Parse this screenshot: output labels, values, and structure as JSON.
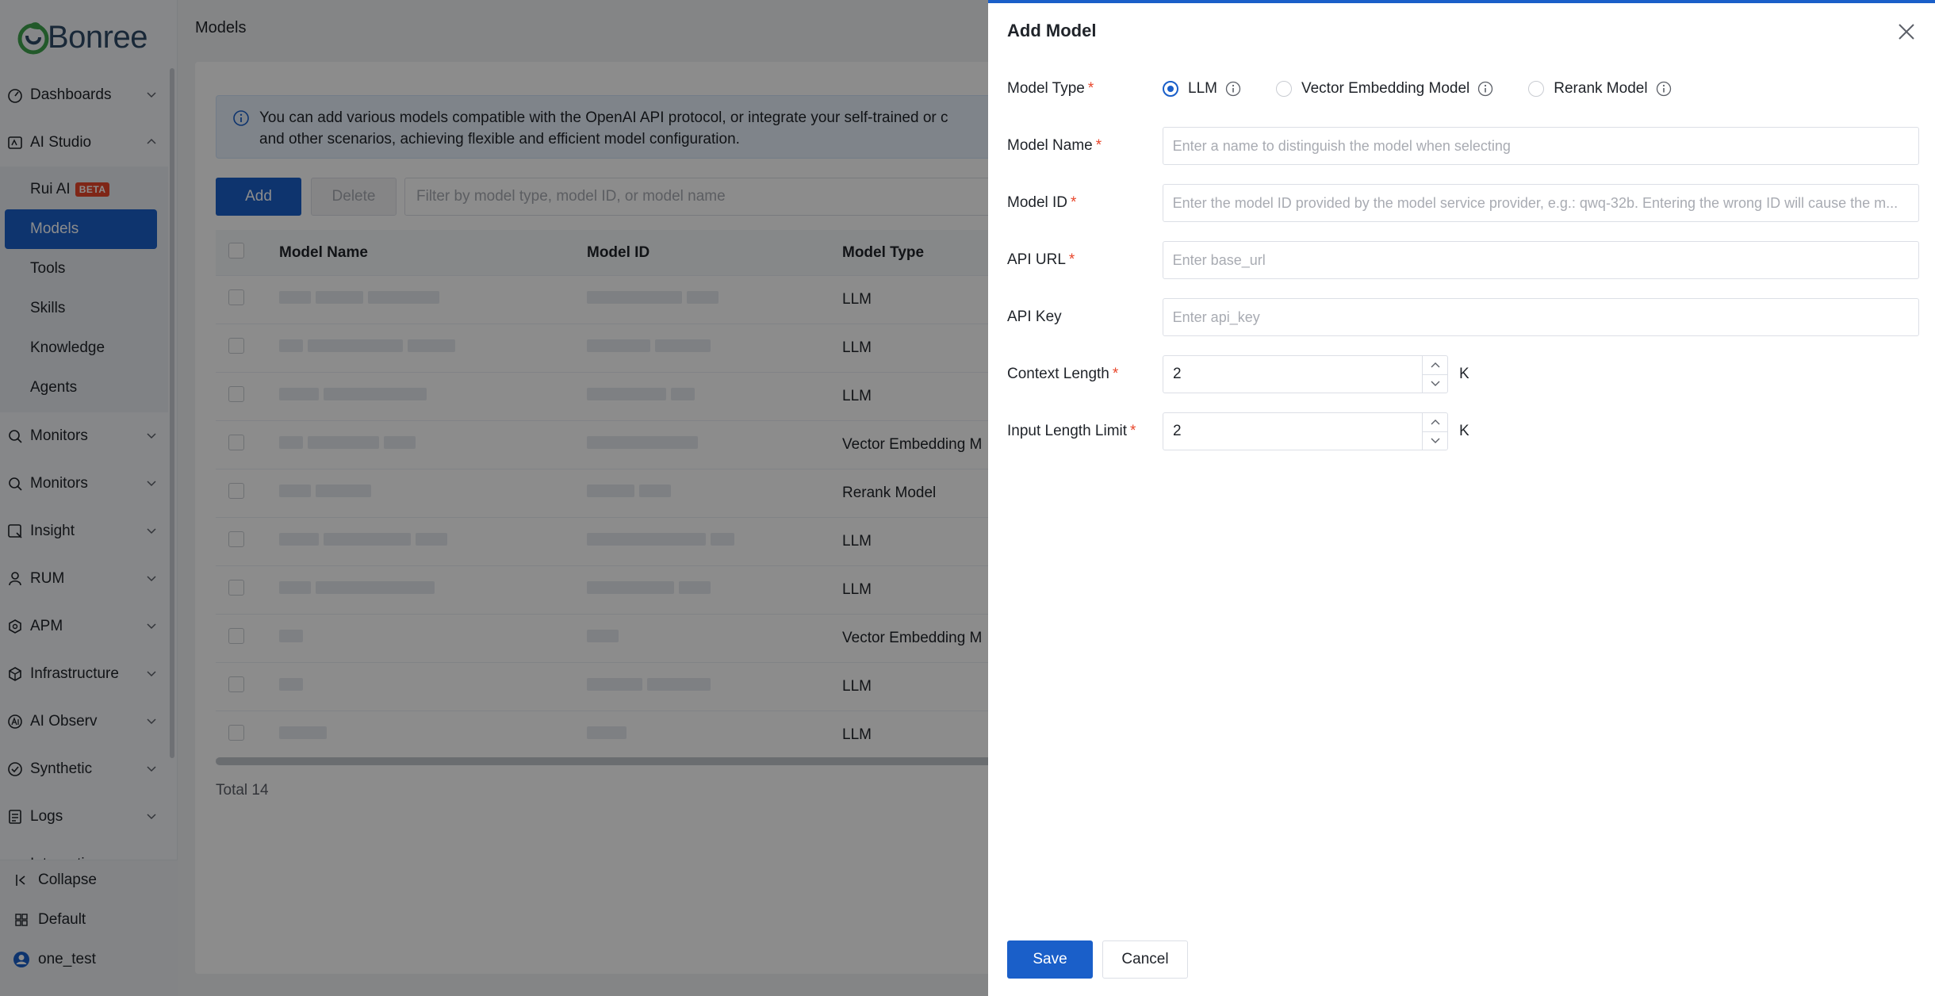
{
  "brand": {
    "name": "Bonree",
    "logo_icon": "bonree-logo-icon",
    "accent": "#1a5fc9"
  },
  "sidebar": {
    "groups": [
      {
        "label": "Dashboards",
        "icon": "dashboard-icon"
      },
      {
        "label": "AI Studio",
        "icon": "ai-studio-icon",
        "expanded": true,
        "items": [
          {
            "label": "Rui AI",
            "badge": "BETA"
          },
          {
            "label": "Models",
            "active": true
          },
          {
            "label": "Tools"
          },
          {
            "label": "Skills"
          },
          {
            "label": "Knowledge"
          },
          {
            "label": "Agents"
          }
        ]
      },
      {
        "label": "Monitors",
        "icon": "monitor-icon"
      },
      {
        "label": "Monitors",
        "icon": "monitor-icon"
      },
      {
        "label": "Insight",
        "icon": "insight-icon"
      },
      {
        "label": "RUM",
        "icon": "rum-icon"
      },
      {
        "label": "APM",
        "icon": "apm-icon"
      },
      {
        "label": "Infrastructure",
        "icon": "infrastructure-icon"
      },
      {
        "label": "AI Observ",
        "icon": "ai-observ-icon"
      },
      {
        "label": "Synthetic",
        "icon": "synthetic-icon"
      },
      {
        "label": "Logs",
        "icon": "logs-icon"
      },
      {
        "label": "Integration",
        "icon": "integration-icon"
      }
    ],
    "bottom": {
      "collapse": "Collapse",
      "workspace": "Default",
      "user": "one_test"
    }
  },
  "main": {
    "breadcrumb": "Models",
    "info": "You can add various models compatible with the OpenAI API protocol, or integrate your self-trained or c",
    "info_line2": "and other scenarios, achieving flexible and efficient model configuration.",
    "add_label": "Add",
    "delete_label": "Delete",
    "filter_placeholder": "Filter by model type, model ID, or model name",
    "table": {
      "columns": [
        "Model Name",
        "Model ID",
        "Model Type"
      ],
      "rows": [
        {
          "type": "LLM"
        },
        {
          "type": "LLM"
        },
        {
          "type": "LLM"
        },
        {
          "type": "Vector Embedding M"
        },
        {
          "type": "Rerank Model"
        },
        {
          "type": "LLM"
        },
        {
          "type": "LLM"
        },
        {
          "type": "Vector Embedding M"
        },
        {
          "type": "LLM"
        },
        {
          "type": "LLM"
        }
      ]
    },
    "total": "Total 14"
  },
  "drawer": {
    "title": "Add Model",
    "model_type": {
      "label": "Model Type",
      "options": [
        "LLM",
        "Vector Embedding Model",
        "Rerank Model"
      ],
      "selected": "LLM"
    },
    "model_name": {
      "label": "Model Name",
      "placeholder": "Enter a name to distinguish the model when selecting",
      "value": ""
    },
    "model_id": {
      "label": "Model ID",
      "placeholder": "Enter the model ID provided by the model service provider, e.g.: qwq-32b. Entering the wrong ID will cause the m...",
      "value": ""
    },
    "api_url": {
      "label": "API URL",
      "placeholder": "Enter base_url",
      "value": ""
    },
    "api_key": {
      "label": "API Key",
      "placeholder": "Enter api_key",
      "value": ""
    },
    "context_length": {
      "label": "Context Length",
      "value": "2",
      "unit": "K"
    },
    "input_length_limit": {
      "label": "Input Length Limit",
      "value": "2",
      "unit": "K"
    },
    "save_label": "Save",
    "cancel_label": "Cancel"
  }
}
